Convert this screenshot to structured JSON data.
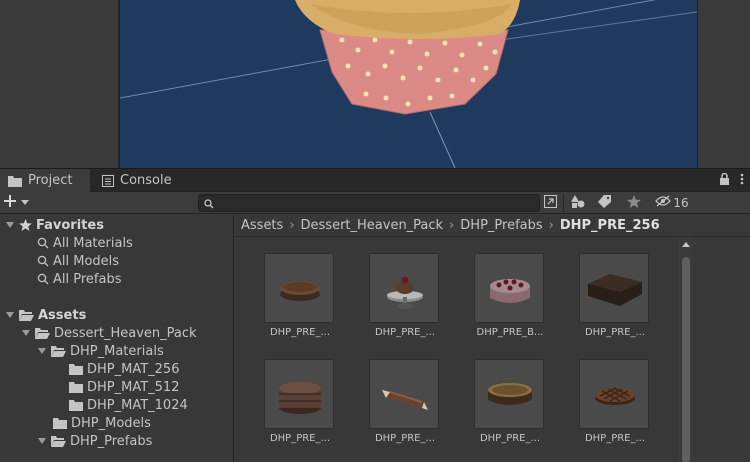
{
  "tabs": {
    "project_label": "Project",
    "console_label": "Console"
  },
  "toolbar": {
    "search_placeholder": "",
    "hidden_count": "16"
  },
  "tree": {
    "favorites_label": "Favorites",
    "favorites": [
      "All Materials",
      "All Models",
      "All Prefabs"
    ],
    "assets_label": "Assets",
    "pack_label": "Dessert_Heaven_Pack",
    "materials_label": "DHP_Materials",
    "materials": [
      "DHP_MAT_256",
      "DHP_MAT_512",
      "DHP_MAT_1024"
    ],
    "models_label": "DHP_Models",
    "prefabs_label": "DHP_Prefabs"
  },
  "breadcrumb": [
    "Assets",
    "Dessert_Heaven_Pack",
    "DHP_Prefabs",
    "DHP_PRE_256"
  ],
  "assets": [
    {
      "label": "DHP_PRE_...",
      "icon": "tart-thumbnail"
    },
    {
      "label": "DHP_PRE_...",
      "icon": "cupcake-stand-thumbnail"
    },
    {
      "label": "DHP_PRE_B...",
      "icon": "berry-cake-thumbnail"
    },
    {
      "label": "DHP_PRE_...",
      "icon": "brownie-thumbnail"
    },
    {
      "label": "DHP_PRE_...",
      "icon": "macaron-stack-thumbnail"
    },
    {
      "label": "DHP_PRE_...",
      "icon": "cannoli-thumbnail"
    },
    {
      "label": "DHP_PRE_...",
      "icon": "cheesecake-thumbnail"
    },
    {
      "label": "DHP_PRE_...",
      "icon": "lattice-pie-thumbnail"
    }
  ],
  "colors": {
    "scene_bg": "#1e3a5f",
    "panel_bg": "#383838",
    "tab_bg": "#282828"
  }
}
